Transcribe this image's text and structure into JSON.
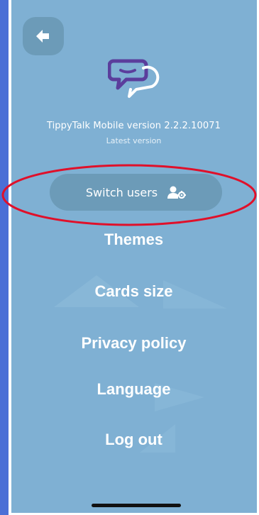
{
  "app": {
    "version_line": "TippyTalk Mobile version 2.2.2.10071",
    "version_status": "Latest version"
  },
  "switch_users": {
    "label": "Switch users",
    "icon": "user-gear-icon"
  },
  "menu": {
    "items": [
      {
        "label": "Themes"
      },
      {
        "label": "Cards size"
      },
      {
        "label": "Privacy policy"
      },
      {
        "label": "Language"
      },
      {
        "label": "Log out"
      }
    ]
  },
  "colors": {
    "screen_bg": "#7fb0d3",
    "button_bg": "#6c9bb8",
    "page_bg": "#4b6fd6",
    "highlight": "#e0102a",
    "logo_purple": "#5b3e9c"
  }
}
